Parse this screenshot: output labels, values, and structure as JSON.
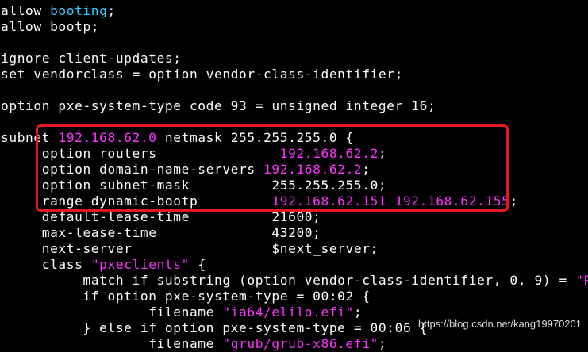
{
  "lines": [
    [
      "allow ",
      "booting",
      ";"
    ],
    [
      "allow bootp;"
    ],
    [
      ""
    ],
    [
      "ignore client-updates;"
    ],
    [
      "set vendorclass = option vendor-class-identifier;"
    ],
    [
      ""
    ],
    [
      "option pxe-system-type code 93 = unsigned integer 16;"
    ],
    [
      ""
    ],
    [
      "subnet ",
      "192.168.62.0",
      " netmask 255.255.255.0 {"
    ],
    [
      "     option routers               ",
      "192.168.62.2",
      ";"
    ],
    [
      "     option domain-name-servers ",
      "192.168.62.2",
      ";"
    ],
    [
      "     option subnet-mask          255.255.255.0;"
    ],
    [
      "     range dynamic-bootp         ",
      "192.168.62.151 192.168.62.155",
      ";"
    ],
    [
      "     default-lease-time          21600;"
    ],
    [
      "     max-lease-time              43200;"
    ],
    [
      "     next-server                 $next_server;"
    ],
    [
      "     class ",
      "\"pxeclients\"",
      " {"
    ],
    [
      "          match if substring (option vendor-class-identifier, 0, 9) = ",
      "\"PXE"
    ],
    [
      "          if option pxe-system-type = 00:02 {"
    ],
    [
      "                  filename ",
      "\"ia64/elilo.efi\"",
      ";"
    ],
    [
      "          } else if option pxe-system-type = 00:06 {"
    ],
    [
      "                  filename ",
      "\"grub/grub-x86.efi\"",
      ";"
    ]
  ],
  "watermark": "https://blog.csdn.net/kang19970201",
  "colors": {
    "background": "#000000",
    "text": "#ffffff",
    "keyword_cyan": "#33ccff",
    "value_magenta": "#ff33ff",
    "highlight_red": "#e8141e"
  }
}
